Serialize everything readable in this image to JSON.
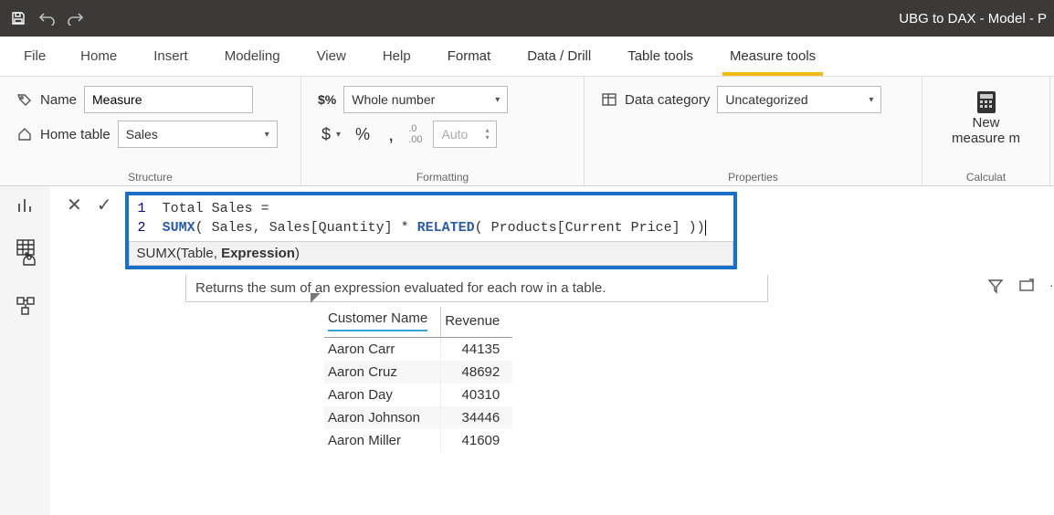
{
  "titlebar": {
    "app_title": "UBG to DAX - Model - P"
  },
  "tabs": {
    "file": "File",
    "home": "Home",
    "insert": "Insert",
    "modeling": "Modeling",
    "view": "View",
    "help": "Help",
    "format": "Format",
    "data_drill": "Data / Drill",
    "table_tools": "Table tools",
    "measure_tools": "Measure tools"
  },
  "structure": {
    "name_label": "Name",
    "name_value": "Measure",
    "home_table_label": "Home table",
    "home_table_value": "Sales",
    "caption": "Structure"
  },
  "formatting": {
    "format_value": "Whole number",
    "currency": "$",
    "percent": "%",
    "comma": ",",
    "decimal_icon": ".00",
    "auto": "Auto",
    "caption": "Formatting"
  },
  "properties": {
    "data_category_label": "Data category",
    "data_category_value": "Uncategorized",
    "caption": "Properties"
  },
  "calculations": {
    "new_measure_label1": "New",
    "new_measure_label2": "measure  m",
    "caption": "Calculat"
  },
  "formula": {
    "line1_num": "1",
    "line1_text": "Total Sales =",
    "line2_num": "2",
    "line2_kw1": "SUMX",
    "line2_seg1": "( Sales, Sales[Quantity] * ",
    "line2_kw2": "RELATED",
    "line2_seg2": "( Products[Current Price] )",
    "sig_fn": "SUMX(",
    "sig_arg1": "Table, ",
    "sig_arg2": "Expression",
    "sig_close": ")",
    "desc": "Returns the sum of an expression evaluated for each row in a table."
  },
  "table": {
    "columns": [
      "Customer Name",
      "Revenue"
    ],
    "rows": [
      [
        "Aaron Carr",
        "44135"
      ],
      [
        "Aaron Cruz",
        "48692"
      ],
      [
        "Aaron Day",
        "40310"
      ],
      [
        "Aaron Johnson",
        "34446"
      ],
      [
        "Aaron Miller",
        "41609"
      ]
    ]
  }
}
